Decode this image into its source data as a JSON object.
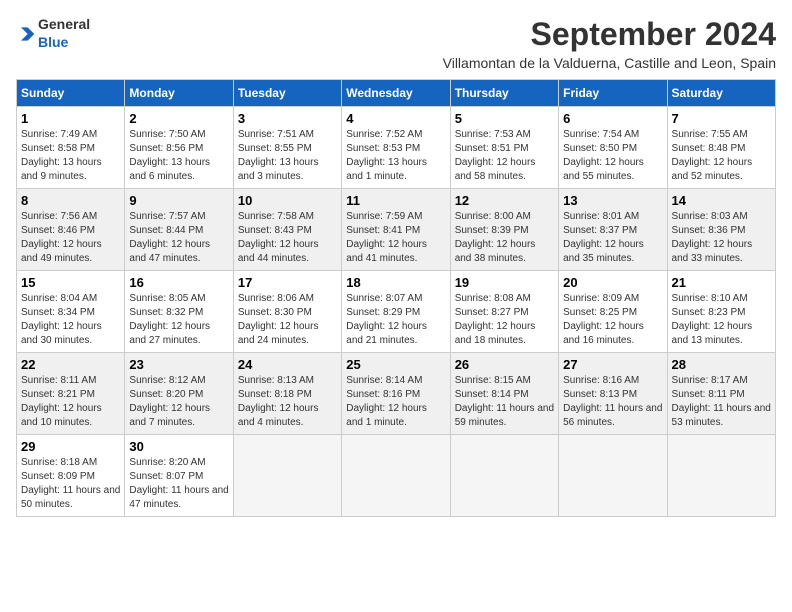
{
  "header": {
    "logo_general": "General",
    "logo_blue": "Blue",
    "title": "September 2024",
    "subtitle": "Villamontan de la Valduerna, Castille and Leon, Spain"
  },
  "calendar": {
    "columns": [
      "Sunday",
      "Monday",
      "Tuesday",
      "Wednesday",
      "Thursday",
      "Friday",
      "Saturday"
    ],
    "weeks": [
      [
        null,
        null,
        null,
        null,
        null,
        null,
        null
      ]
    ],
    "days": [
      {
        "date": 1,
        "sunrise": "7:49 AM",
        "sunset": "8:58 PM",
        "daylight": "13 hours and 9 minutes."
      },
      {
        "date": 2,
        "sunrise": "7:50 AM",
        "sunset": "8:56 PM",
        "daylight": "13 hours and 6 minutes."
      },
      {
        "date": 3,
        "sunrise": "7:51 AM",
        "sunset": "8:55 PM",
        "daylight": "13 hours and 3 minutes."
      },
      {
        "date": 4,
        "sunrise": "7:52 AM",
        "sunset": "8:53 PM",
        "daylight": "13 hours and 1 minute."
      },
      {
        "date": 5,
        "sunrise": "7:53 AM",
        "sunset": "8:51 PM",
        "daylight": "12 hours and 58 minutes."
      },
      {
        "date": 6,
        "sunrise": "7:54 AM",
        "sunset": "8:50 PM",
        "daylight": "12 hours and 55 minutes."
      },
      {
        "date": 7,
        "sunrise": "7:55 AM",
        "sunset": "8:48 PM",
        "daylight": "12 hours and 52 minutes."
      },
      {
        "date": 8,
        "sunrise": "7:56 AM",
        "sunset": "8:46 PM",
        "daylight": "12 hours and 49 minutes."
      },
      {
        "date": 9,
        "sunrise": "7:57 AM",
        "sunset": "8:44 PM",
        "daylight": "12 hours and 47 minutes."
      },
      {
        "date": 10,
        "sunrise": "7:58 AM",
        "sunset": "8:43 PM",
        "daylight": "12 hours and 44 minutes."
      },
      {
        "date": 11,
        "sunrise": "7:59 AM",
        "sunset": "8:41 PM",
        "daylight": "12 hours and 41 minutes."
      },
      {
        "date": 12,
        "sunrise": "8:00 AM",
        "sunset": "8:39 PM",
        "daylight": "12 hours and 38 minutes."
      },
      {
        "date": 13,
        "sunrise": "8:01 AM",
        "sunset": "8:37 PM",
        "daylight": "12 hours and 35 minutes."
      },
      {
        "date": 14,
        "sunrise": "8:03 AM",
        "sunset": "8:36 PM",
        "daylight": "12 hours and 33 minutes."
      },
      {
        "date": 15,
        "sunrise": "8:04 AM",
        "sunset": "8:34 PM",
        "daylight": "12 hours and 30 minutes."
      },
      {
        "date": 16,
        "sunrise": "8:05 AM",
        "sunset": "8:32 PM",
        "daylight": "12 hours and 27 minutes."
      },
      {
        "date": 17,
        "sunrise": "8:06 AM",
        "sunset": "8:30 PM",
        "daylight": "12 hours and 24 minutes."
      },
      {
        "date": 18,
        "sunrise": "8:07 AM",
        "sunset": "8:29 PM",
        "daylight": "12 hours and 21 minutes."
      },
      {
        "date": 19,
        "sunrise": "8:08 AM",
        "sunset": "8:27 PM",
        "daylight": "12 hours and 18 minutes."
      },
      {
        "date": 20,
        "sunrise": "8:09 AM",
        "sunset": "8:25 PM",
        "daylight": "12 hours and 16 minutes."
      },
      {
        "date": 21,
        "sunrise": "8:10 AM",
        "sunset": "8:23 PM",
        "daylight": "12 hours and 13 minutes."
      },
      {
        "date": 22,
        "sunrise": "8:11 AM",
        "sunset": "8:21 PM",
        "daylight": "12 hours and 10 minutes."
      },
      {
        "date": 23,
        "sunrise": "8:12 AM",
        "sunset": "8:20 PM",
        "daylight": "12 hours and 7 minutes."
      },
      {
        "date": 24,
        "sunrise": "8:13 AM",
        "sunset": "8:18 PM",
        "daylight": "12 hours and 4 minutes."
      },
      {
        "date": 25,
        "sunrise": "8:14 AM",
        "sunset": "8:16 PM",
        "daylight": "12 hours and 1 minute."
      },
      {
        "date": 26,
        "sunrise": "8:15 AM",
        "sunset": "8:14 PM",
        "daylight": "11 hours and 59 minutes."
      },
      {
        "date": 27,
        "sunrise": "8:16 AM",
        "sunset": "8:13 PM",
        "daylight": "11 hours and 56 minutes."
      },
      {
        "date": 28,
        "sunrise": "8:17 AM",
        "sunset": "8:11 PM",
        "daylight": "11 hours and 53 minutes."
      },
      {
        "date": 29,
        "sunrise": "8:18 AM",
        "sunset": "8:09 PM",
        "daylight": "11 hours and 50 minutes."
      },
      {
        "date": 30,
        "sunrise": "8:20 AM",
        "sunset": "8:07 PM",
        "daylight": "11 hours and 47 minutes."
      }
    ]
  }
}
